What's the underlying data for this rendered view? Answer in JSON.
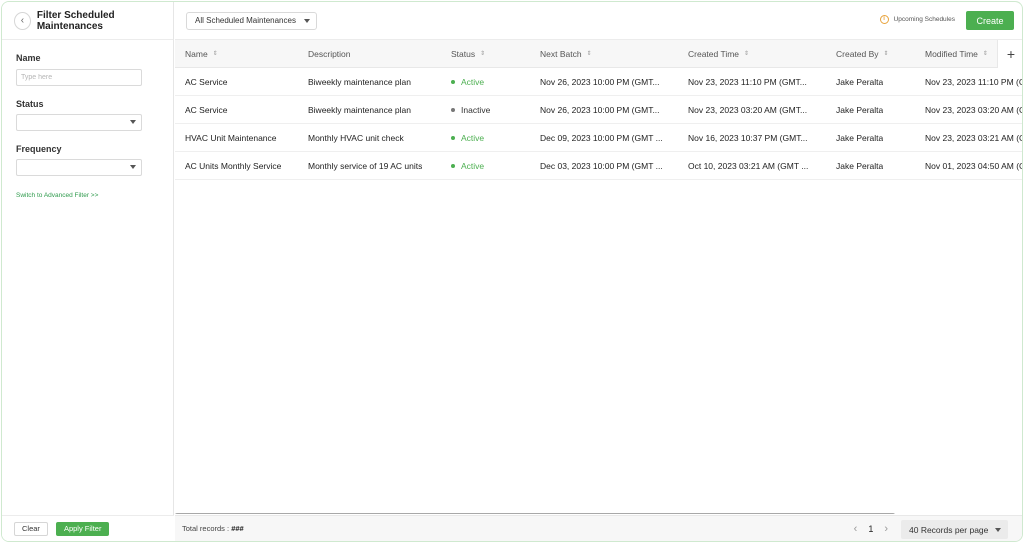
{
  "filter_panel": {
    "title": "Filter Scheduled Maintenances",
    "name_label": "Name",
    "name_placeholder": "Type here",
    "status_label": "Status",
    "frequency_label": "Frequency",
    "advanced_link": "Switch to Advanced Filter >>",
    "clear_label": "Clear",
    "apply_label": "Apply Filter"
  },
  "topbar": {
    "view_selected": "All Scheduled Maintenances",
    "upcoming_label": "Upcoming Schedules",
    "create_label": "Create"
  },
  "table": {
    "columns": [
      "Name",
      "Description",
      "Status",
      "Next Batch",
      "Created Time",
      "Created By",
      "Modified Time"
    ],
    "rows": [
      [
        "AC Service",
        "Biweekly maintenance plan",
        "Active",
        "Nov 26, 2023 10:00 PM (GMT...",
        "Nov 23, 2023 11:10 PM (GMT...",
        "Jake Peralta",
        "Nov 23, 2023 11:10 PM (G"
      ],
      [
        "AC Service",
        "Biweekly maintenance plan",
        "Inactive",
        "Nov 26, 2023 10:00 PM (GMT...",
        "Nov 23, 2023 03:20 AM (GMT...",
        "Jake Peralta",
        "Nov 23, 2023 03:20 AM (G"
      ],
      [
        "HVAC Unit Maintenance",
        "Monthly HVAC unit check",
        "Active",
        "Dec 09, 2023 10:00 PM (GMT ...",
        "Nov 16, 2023 10:37 PM (GMT...",
        "Jake Peralta",
        "Nov 23, 2023 03:21 AM (G"
      ],
      [
        "AC Units Monthly Service",
        "Monthly service of 19 AC units",
        "Active",
        "Dec 03, 2023 10:00 PM (GMT ...",
        "Oct 10, 2023 03:21 AM (GMT ...",
        "Jake Peralta",
        "Nov 01, 2023 04:50 AM (G"
      ]
    ]
  },
  "footer": {
    "total_label": "Total records :",
    "total_value": "###",
    "page": "1",
    "per_page": "40 Records per page"
  },
  "colors": {
    "accent": "#4caf50",
    "info": "#e8a33c"
  }
}
